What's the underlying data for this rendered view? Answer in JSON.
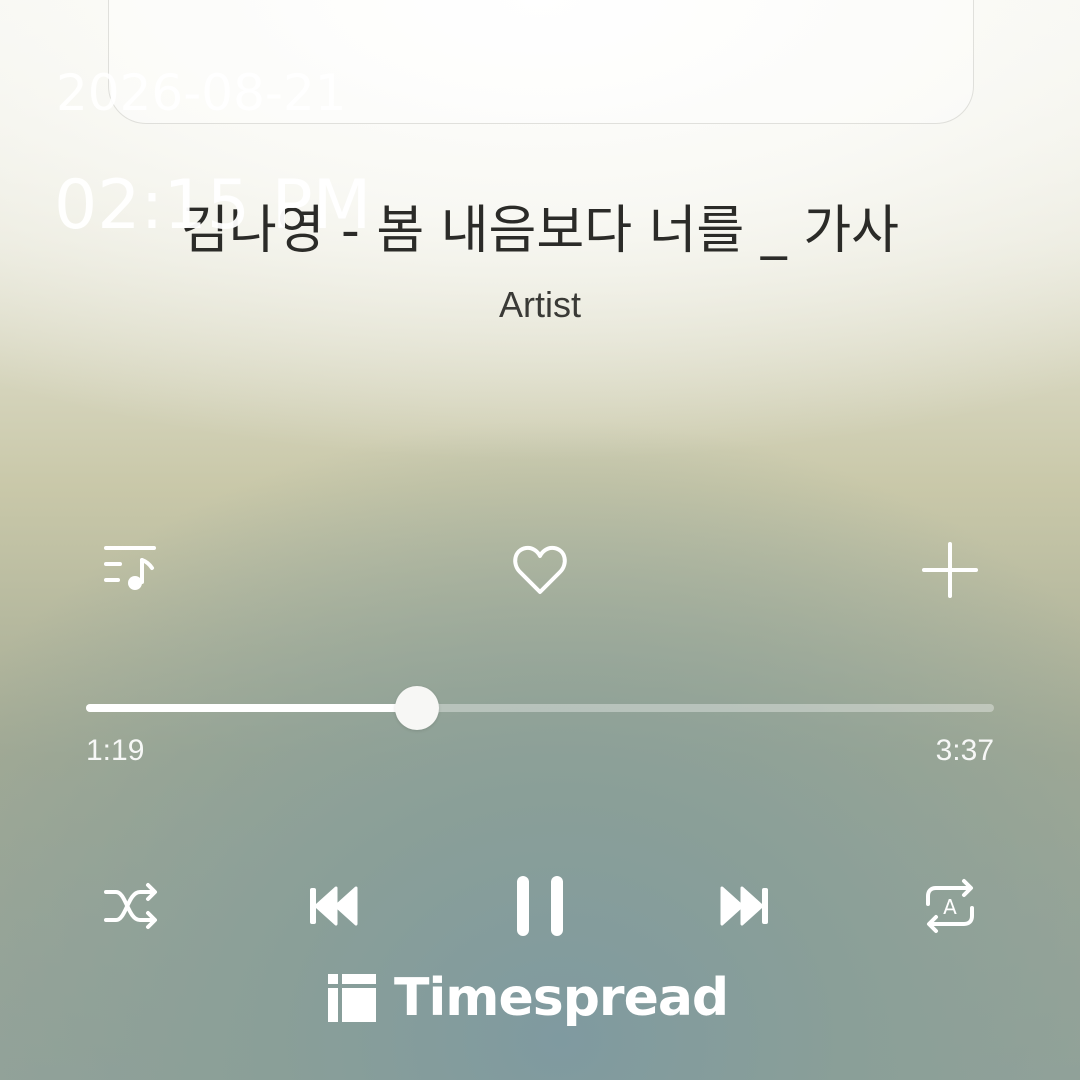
{
  "overlay": {
    "date": "2026-08-21",
    "time": "02:15 PM"
  },
  "track": {
    "title": "김나영 - 봄 내음보다 너를 _ 가사",
    "artist": "Artist"
  },
  "progress": {
    "elapsed": "1:19",
    "duration": "3:37",
    "fraction": 0.364
  },
  "actions": {
    "left_icon": "queue-music-icon",
    "center_icon": "heart-icon",
    "right_icon": "plus-icon"
  },
  "controls": {
    "shuffle_icon": "shuffle-icon",
    "previous_icon": "previous-track-icon",
    "play_state_icon": "pause-icon",
    "next_icon": "next-track-icon",
    "repeat_icon": "repeat-ab-icon",
    "repeat_letter": "A"
  },
  "watermark": {
    "brand": "Timespread"
  }
}
